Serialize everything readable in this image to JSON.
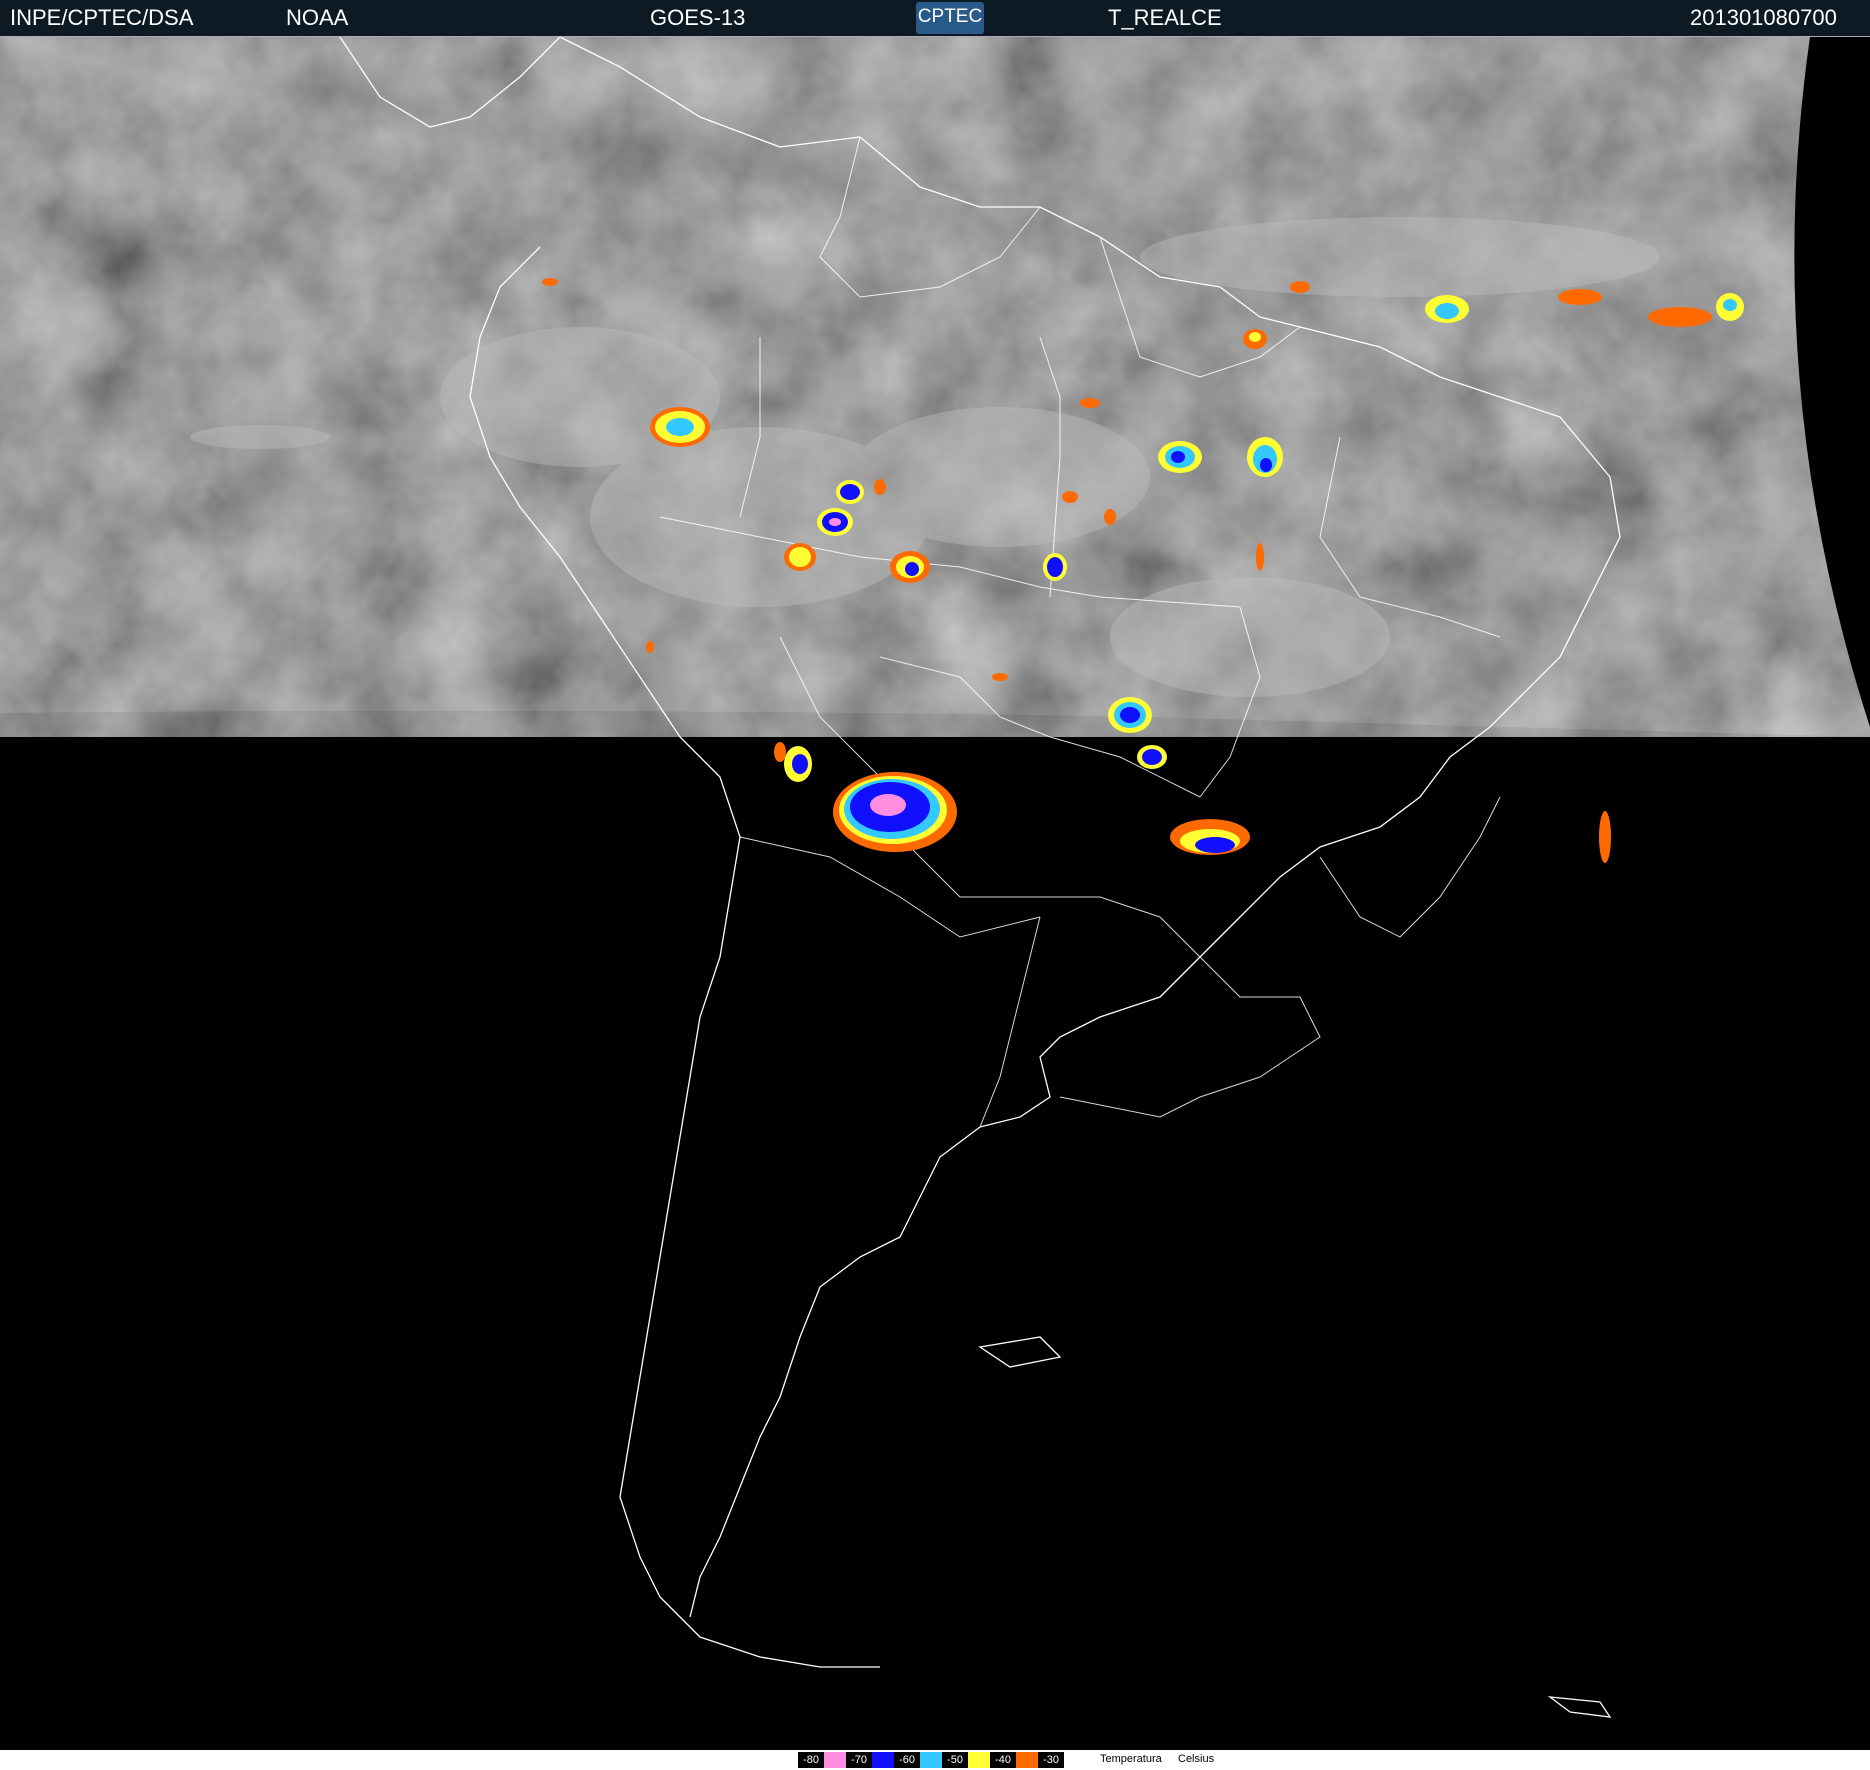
{
  "header": {
    "source": "INPE/CPTEC/DSA",
    "agency": "NOAA",
    "satellite": "GOES-13",
    "logo": "CPTEC",
    "product": "T_REALCE",
    "timestamp": "201301080700"
  },
  "legend": {
    "items": [
      {
        "label": "-80",
        "color": "#ff8ee0"
      },
      {
        "label": "-70",
        "color": "#1010ff"
      },
      {
        "label": "-60",
        "color": "#33c8ff"
      },
      {
        "label": "-50",
        "color": "#ffff33"
      },
      {
        "label": "-40",
        "color": "#ff6a00"
      },
      {
        "label": "-30",
        "color": "#ff6a00"
      }
    ],
    "unit_title": "Temperatura",
    "unit": "Celsius"
  },
  "colors": {
    "night": "#000000",
    "cloud_gray": "#5a5a5a",
    "coastline": "#ffffff"
  }
}
